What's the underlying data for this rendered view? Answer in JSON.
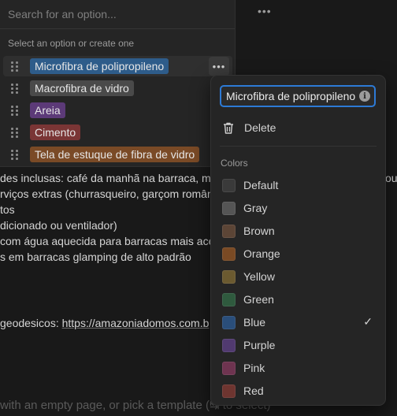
{
  "page": {
    "more_button": "•••",
    "lines": [
      "des inclusas: café da manhã na barraca, mont",
      "rviços extras (churrasqueiro, garçom românt",
      "tos",
      "dicionado ou ventilador)",
      "com água aquecida para barracas mais aces",
      "s em barracas glamping de alto padrão"
    ],
    "link_prefix": " geodesicos: ",
    "link_text": "https://amazoniadomos.com.b",
    "right_edge_text": "ou",
    "bottom_hint": "with an empty page, or pick a template (↹ to select)"
  },
  "select": {
    "search_placeholder": "Search for an option...",
    "hint": "Select an option or create one",
    "more_icon_text": "•••",
    "options": [
      {
        "label": "Microfibra de polipropileno",
        "color": "#2e5c8a"
      },
      {
        "label": "Macrofibra de vidro",
        "color": "#4a4a4a"
      },
      {
        "label": "Areia",
        "color": "#5c3a78"
      },
      {
        "label": "Cimento",
        "color": "#7a3535"
      },
      {
        "label": "Tela de estuque de fibra de vidro",
        "color": "#7a4a26"
      }
    ]
  },
  "menu": {
    "name_value": "Microfibra de polipropileno",
    "info_icon_text": "i",
    "delete_label": "Delete",
    "colors_label": "Colors",
    "check_mark": "✓",
    "selected_color": "Blue",
    "colors": [
      {
        "label": "Default",
        "swatch": "#3a3a3a"
      },
      {
        "label": "Gray",
        "swatch": "#555555"
      },
      {
        "label": "Brown",
        "swatch": "#5c4536"
      },
      {
        "label": "Orange",
        "swatch": "#7a4a24"
      },
      {
        "label": "Yellow",
        "swatch": "#6b5a30"
      },
      {
        "label": "Green",
        "swatch": "#2f5a3e"
      },
      {
        "label": "Blue",
        "swatch": "#2a4e7a"
      },
      {
        "label": "Purple",
        "swatch": "#513a70"
      },
      {
        "label": "Pink",
        "swatch": "#6e3450"
      },
      {
        "label": "Red",
        "swatch": "#6e3530"
      }
    ]
  }
}
